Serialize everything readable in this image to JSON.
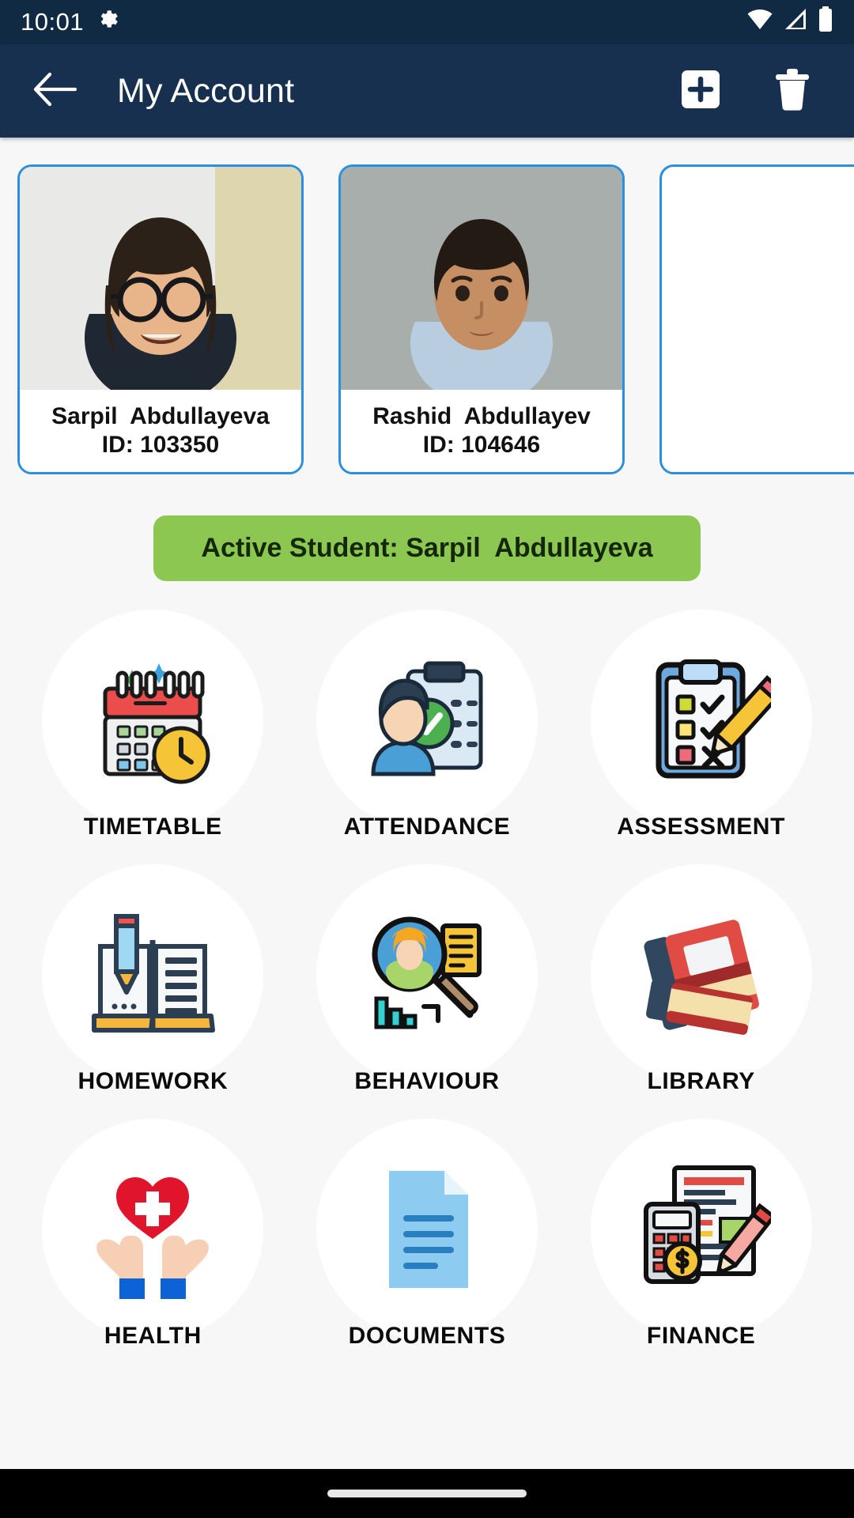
{
  "status_bar": {
    "time": "10:01",
    "icons": [
      "gear-icon",
      "wifi-icon",
      "cellular-signal-icon",
      "battery-icon"
    ]
  },
  "app_bar": {
    "back_label": "",
    "title": "My Account",
    "add_label": "",
    "delete_label": ""
  },
  "students": [
    {
      "name": "Sarpil  Abdullayeva",
      "id_label": "ID: 103350"
    },
    {
      "name": "Rashid  Abdullayev",
      "id_label": "ID: 104646"
    },
    {
      "name": "",
      "id_label": ""
    }
  ],
  "active_student": {
    "text": "Active Student: Sarpil  Abdullayeva",
    "color": "#8cc751"
  },
  "menu": [
    {
      "label": "TIMETABLE",
      "icon": "calendar-clock-icon"
    },
    {
      "label": "ATTENDANCE",
      "icon": "clipboard-check-person-icon"
    },
    {
      "label": "ASSESSMENT",
      "icon": "clipboard-pencil-icon"
    },
    {
      "label": "HOMEWORK",
      "icon": "book-pencil-icon"
    },
    {
      "label": "BEHAVIOUR",
      "icon": "magnifier-person-chart-icon"
    },
    {
      "label": "LIBRARY",
      "icon": "books-icon"
    },
    {
      "label": "HEALTH",
      "icon": "hands-heart-icon"
    },
    {
      "label": "DOCUMENTS",
      "icon": "document-icon"
    },
    {
      "label": "FINANCE",
      "icon": "calculator-invoice-icon"
    }
  ],
  "theme": {
    "status_bar_bg": "#102a43",
    "app_bar_bg": "#17304f",
    "page_bg": "#f7f7f7",
    "card_border": "#2a8fe0",
    "accent_green": "#8cc751"
  },
  "nav_bar": {
    "gesture_pill": ""
  }
}
